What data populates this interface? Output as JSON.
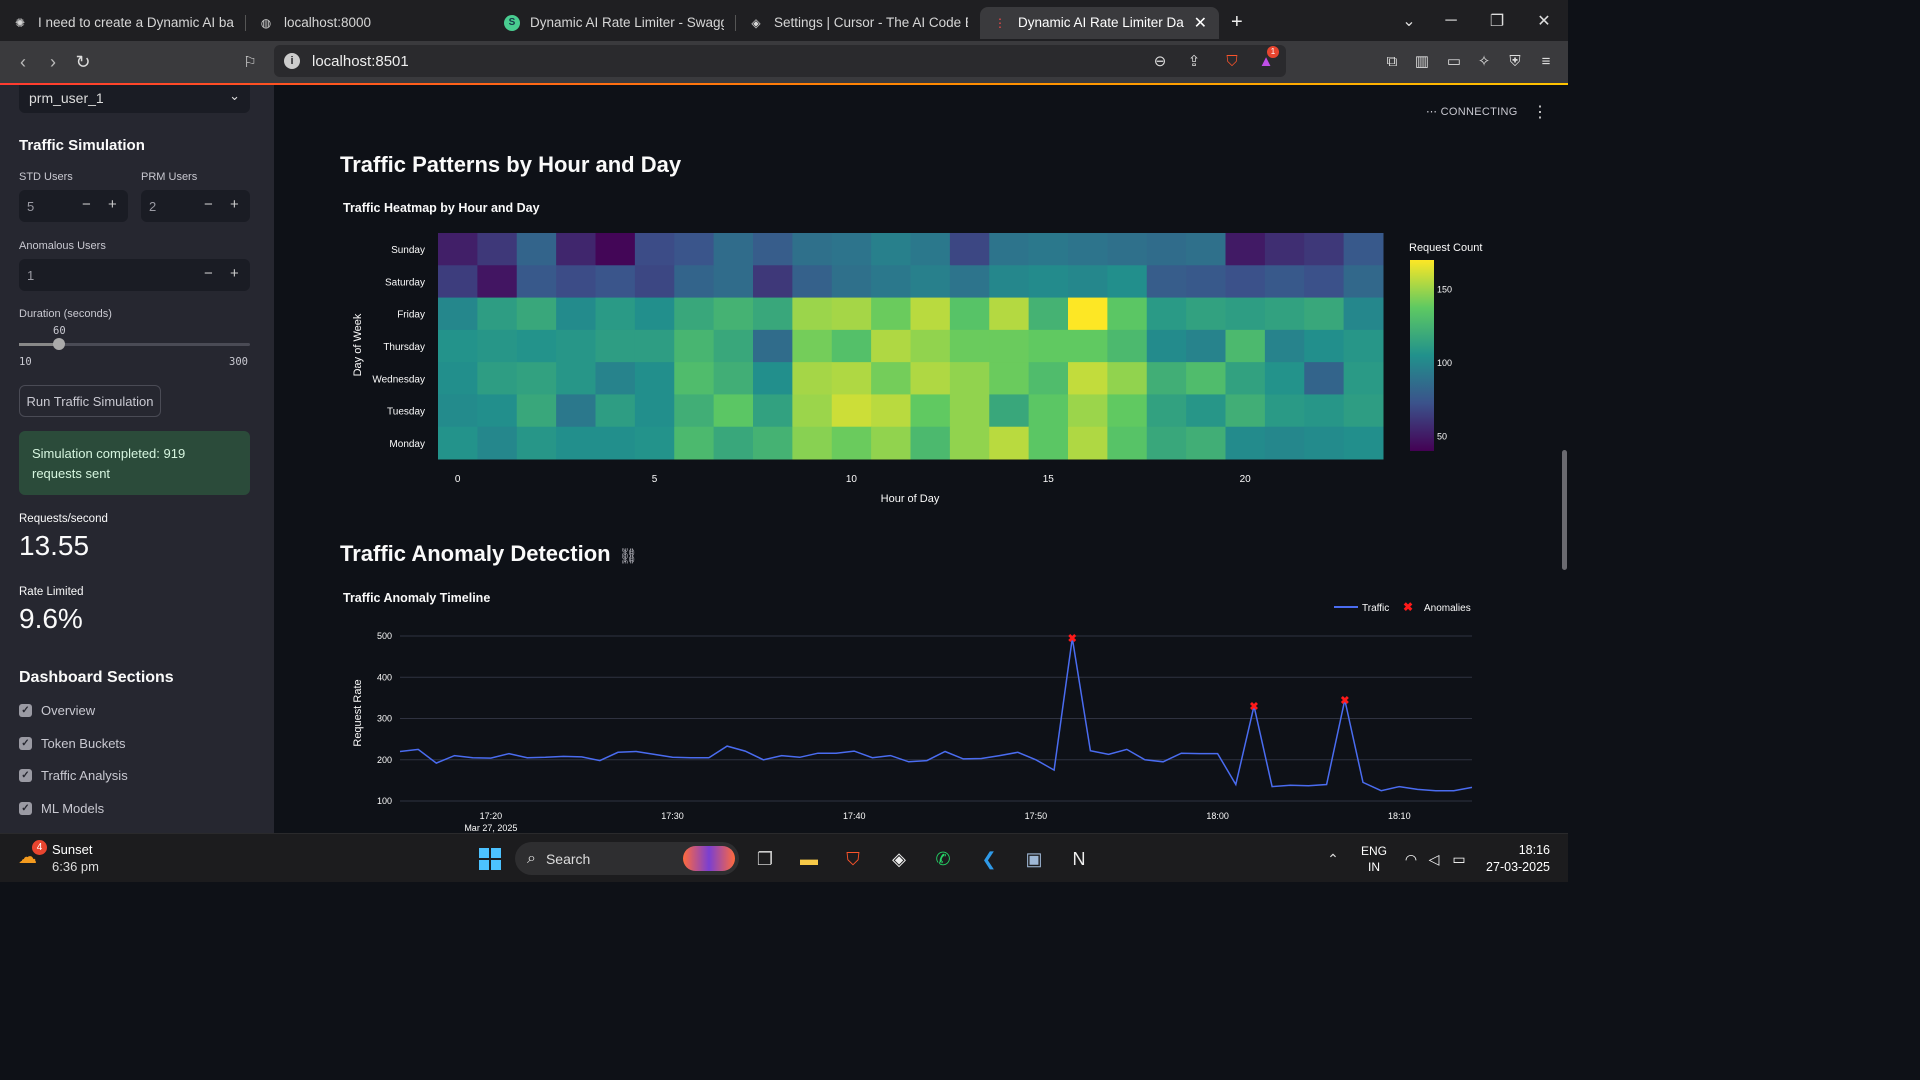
{
  "browser": {
    "tabs": [
      {
        "title": "I need to create a Dynamic AI based",
        "icon": "chatgpt-icon"
      },
      {
        "title": "localhost:8000",
        "icon": "globe-icon"
      },
      {
        "title": "Dynamic AI Rate Limiter - Swagger UI",
        "icon": "swagger-icon"
      },
      {
        "title": "Settings | Cursor - The AI Code Editor",
        "icon": "cursor-icon"
      },
      {
        "title": "Dynamic AI Rate Limiter Dashboard",
        "icon": "streamlit-icon"
      }
    ],
    "url": "localhost:8501",
    "shield_badge": "1"
  },
  "sidebar": {
    "user_select": "prm_user_1",
    "traffic_heading": "Traffic Simulation",
    "std_label": "STD Users",
    "std_value": "5",
    "prm_label": "PRM Users",
    "prm_value": "2",
    "anom_label": "Anomalous Users",
    "anom_value": "1",
    "duration_label": "Duration (seconds)",
    "duration_value": "60",
    "duration_min": "10",
    "duration_max": "300",
    "run_button": "Run Traffic Simulation",
    "success_msg": "Simulation completed: 919 requests sent",
    "rps_label": "Requests/second",
    "rps_value": "13.55",
    "rl_label": "Rate Limited",
    "rl_value": "9.6%",
    "sections_heading": "Dashboard Sections",
    "sections": [
      "Overview",
      "Token Buckets",
      "Traffic Analysis",
      "ML Models"
    ]
  },
  "main": {
    "status": "CONNECTING",
    "heatmap_section_title": "Traffic Patterns by Hour and Day",
    "anomaly_section_title": "Traffic Anomaly Detection"
  },
  "chart_data": [
    {
      "type": "heatmap",
      "title": "Traffic Heatmap by Hour and Day",
      "xlabel": "Hour of Day",
      "ylabel": "Day of Week",
      "colorbar_title": "Request Count",
      "colorbar_ticks": [
        50,
        100,
        150
      ],
      "colorscale": "viridis",
      "zrange": [
        40,
        170
      ],
      "x": [
        0,
        1,
        2,
        3,
        4,
        5,
        6,
        7,
        8,
        9,
        10,
        11,
        12,
        13,
        14,
        15,
        16,
        17,
        18,
        19,
        20,
        21,
        22,
        23
      ],
      "x_ticks": [
        0,
        5,
        10,
        15,
        20
      ],
      "y": [
        "Sunday",
        "Saturday",
        "Friday",
        "Thursday",
        "Wednesday",
        "Tuesday",
        "Monday"
      ],
      "z": [
        [
          52,
          62,
          82,
          55,
          42,
          70,
          74,
          86,
          78,
          88,
          90,
          96,
          92,
          68,
          90,
          92,
          90,
          88,
          86,
          88,
          50,
          58,
          62,
          76
        ],
        [
          64,
          48,
          76,
          70,
          74,
          68,
          82,
          86,
          62,
          80,
          88,
          92,
          96,
          90,
          100,
          102,
          100,
          104,
          78,
          76,
          72,
          76,
          72,
          84
        ],
        [
          100,
          112,
          118,
          102,
          110,
          104,
          118,
          124,
          118,
          150,
          152,
          140,
          156,
          134,
          155,
          124,
          170,
          136,
          110,
          114,
          112,
          114,
          118,
          100
        ],
        [
          106,
          108,
          106,
          108,
          112,
          112,
          126,
          118,
          86,
          142,
          132,
          154,
          148,
          140,
          140,
          138,
          138,
          128,
          102,
          98,
          128,
          98,
          104,
          108
        ],
        [
          104,
          112,
          114,
          108,
          98,
          104,
          130,
          122,
          104,
          152,
          154,
          142,
          154,
          148,
          140,
          130,
          158,
          148,
          122,
          130,
          114,
          106,
          82,
          110
        ],
        [
          102,
          104,
          118,
          92,
          112,
          104,
          122,
          136,
          114,
          150,
          160,
          156,
          138,
          148,
          118,
          136,
          150,
          138,
          114,
          108,
          122,
          110,
          108,
          112
        ],
        [
          106,
          100,
          108,
          104,
          104,
          106,
          128,
          118,
          124,
          146,
          140,
          148,
          128,
          148,
          156,
          136,
          154,
          134,
          118,
          122,
          102,
          100,
          102,
          104
        ]
      ]
    },
    {
      "type": "line",
      "title": "Traffic Anomaly Timeline",
      "xlabel": "",
      "ylabel": "Request Rate",
      "x_ticks": [
        "17:20",
        "17:30",
        "17:40",
        "17:50",
        "18:00",
        "18:10"
      ],
      "x_tick_sub": "Mar 27, 2025",
      "x_range": [
        "17:15",
        "18:14"
      ],
      "ylim": [
        100,
        500
      ],
      "y_ticks": [
        100,
        200,
        300,
        400,
        500
      ],
      "legend_position": "top-right",
      "series": [
        {
          "name": "Traffic",
          "color": "#4a6cf0",
          "x": [
            "17:15",
            "17:16",
            "17:17",
            "17:18",
            "17:19",
            "17:20",
            "17:21",
            "17:22",
            "17:23",
            "17:24",
            "17:25",
            "17:26",
            "17:27",
            "17:28",
            "17:29",
            "17:30",
            "17:31",
            "17:32",
            "17:33",
            "17:34",
            "17:35",
            "17:36",
            "17:37",
            "17:38",
            "17:39",
            "17:40",
            "17:41",
            "17:42",
            "17:43",
            "17:44",
            "17:45",
            "17:46",
            "17:47",
            "17:48",
            "17:49",
            "17:50",
            "17:51",
            "17:52",
            "17:53",
            "17:54",
            "17:55",
            "17:56",
            "17:57",
            "17:58",
            "17:59",
            "18:00",
            "18:01",
            "18:02",
            "18:03",
            "18:04",
            "18:05",
            "18:06",
            "18:07",
            "18:08",
            "18:09",
            "18:10",
            "18:11",
            "18:12",
            "18:13",
            "18:14"
          ],
          "y": [
            220,
            225,
            192,
            210,
            205,
            204,
            215,
            205,
            206,
            208,
            207,
            198,
            218,
            220,
            213,
            206,
            205,
            205,
            233,
            221,
            200,
            210,
            206,
            216,
            216,
            221,
            205,
            210,
            195,
            198,
            220,
            202,
            203,
            210,
            218,
            200,
            175,
            495,
            222,
            213,
            225,
            200,
            195,
            216,
            215,
            215,
            140,
            330,
            135,
            138,
            137,
            140,
            345,
            145,
            125,
            135,
            128,
            125,
            125,
            133
          ]
        },
        {
          "name": "Anomalies",
          "color": "#ff1a1a",
          "marker": "x",
          "x": [
            "17:52",
            "18:02",
            "18:07"
          ],
          "y": [
            495,
            330,
            345
          ]
        }
      ]
    }
  ]
}
